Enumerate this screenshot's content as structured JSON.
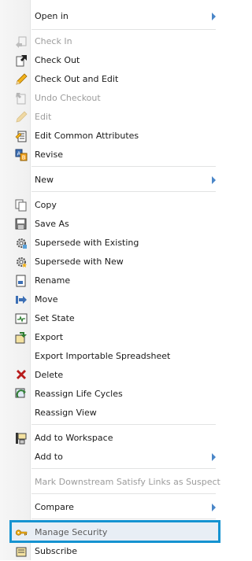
{
  "menu": {
    "items": {
      "open_in": "Open in",
      "check_in": "Check In",
      "check_out": "Check Out",
      "check_out_edit": "Check Out and Edit",
      "undo_checkout": "Undo Checkout",
      "edit": "Edit",
      "edit_common": "Edit Common Attributes",
      "revise": "Revise",
      "new": "New",
      "copy": "Copy",
      "save_as": "Save As",
      "supersede_existing": "Supersede with Existing",
      "supersede_new": "Supersede with New",
      "rename": "Rename",
      "move": "Move",
      "set_state": "Set State",
      "export": "Export",
      "export_spreadsheet": "Export Importable Spreadsheet",
      "delete": "Delete",
      "reassign_lifecycles": "Reassign Life Cycles",
      "reassign_view": "Reassign View",
      "add_workspace": "Add to Workspace",
      "add_to": "Add to",
      "mark_downstream": "Mark Downstream Satisfy Links as Suspect",
      "compare": "Compare",
      "manage_security": "Manage Security",
      "subscribe": "Subscribe"
    }
  },
  "colors": {
    "highlight_border": "#1593d1",
    "submenu_arrow": "#4a86c8",
    "disabled_text": "#9c9c9c"
  }
}
